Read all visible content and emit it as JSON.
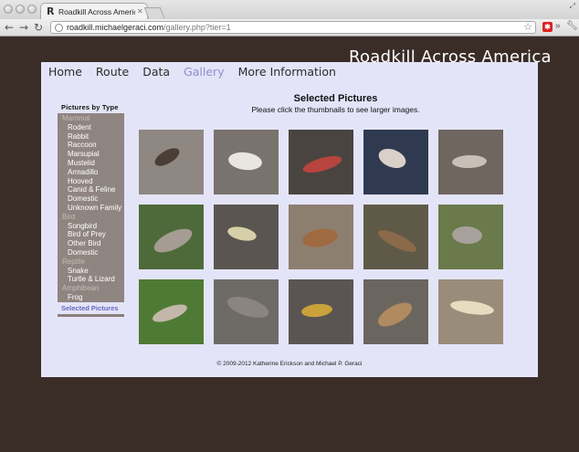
{
  "browser": {
    "tab_title": "Roadkill Across America - G",
    "tab_favicon": "R",
    "url_host": "roadkill.michaelgeraci.com",
    "url_path": "/gallery.php?tier=1",
    "icons": [
      "back-icon",
      "forward-icon",
      "reload-icon",
      "globe-icon",
      "star-icon",
      "extension-icon",
      "more-icon",
      "wrench-icon"
    ]
  },
  "site": {
    "title": "Roadkill Across America"
  },
  "nav": {
    "items": [
      {
        "label": "Home"
      },
      {
        "label": "Route"
      },
      {
        "label": "Data"
      },
      {
        "label": "Gallery",
        "active": true
      },
      {
        "label": "More Information"
      }
    ],
    "active_color": "#8d8fd0"
  },
  "sidebar": {
    "title": "Pictures by Type",
    "items": [
      {
        "label": "Mammal",
        "kind": "category"
      },
      {
        "label": "Rodent",
        "kind": "sub"
      },
      {
        "label": "Rabbit",
        "kind": "sub"
      },
      {
        "label": "Raccoon",
        "kind": "sub"
      },
      {
        "label": "Marsupial",
        "kind": "sub"
      },
      {
        "label": "Mustelid",
        "kind": "sub"
      },
      {
        "label": "Armadillo",
        "kind": "sub"
      },
      {
        "label": "Hooved",
        "kind": "sub"
      },
      {
        "label": "Canid & Feline",
        "kind": "sub"
      },
      {
        "label": "Domestic",
        "kind": "sub"
      },
      {
        "label": "Unknown Family",
        "kind": "sub"
      },
      {
        "label": "Bird",
        "kind": "category"
      },
      {
        "label": "Songbird",
        "kind": "sub"
      },
      {
        "label": "Bird of Prey",
        "kind": "sub"
      },
      {
        "label": "Other Bird",
        "kind": "sub"
      },
      {
        "label": "Domestic",
        "kind": "sub"
      },
      {
        "label": "Reptile",
        "kind": "category"
      },
      {
        "label": "Snake",
        "kind": "sub"
      },
      {
        "label": "Turtle & Lizard",
        "kind": "sub"
      },
      {
        "label": "Amphibean",
        "kind": "category"
      },
      {
        "label": "Frog",
        "kind": "sub"
      }
    ],
    "selected_link": "Selected Pictures"
  },
  "gallery": {
    "heading": "Selected Pictures",
    "subheading": "Please click the thumbnails to see larger images.",
    "thumbnails": [
      {
        "bg": "#8f8782",
        "fg": "#4a3e36"
      },
      {
        "bg": "#7a726c",
        "fg": "#e9e6e0"
      },
      {
        "bg": "#4a4440",
        "fg": "#b7443e"
      },
      {
        "bg": "#2f3a50",
        "fg": "#d9d0c9"
      },
      {
        "bg": "#6f6660",
        "fg": "#c8bfb6"
      },
      {
        "bg": "#4e6a3a",
        "fg": "#a59c93"
      },
      {
        "bg": "#5a5550",
        "fg": "#d6d0a8"
      },
      {
        "bg": "#8d7f70",
        "fg": "#a06a40"
      },
      {
        "bg": "#5f5a48",
        "fg": "#8a6a4a"
      },
      {
        "bg": "#6a7a4a",
        "fg": "#a8a09a"
      },
      {
        "bg": "#4f7a35",
        "fg": "#c3b7aa"
      },
      {
        "bg": "#6e6a66",
        "fg": "#8a8580"
      },
      {
        "bg": "#5a5552",
        "fg": "#c9a23a"
      },
      {
        "bg": "#6b6560",
        "fg": "#b08a60"
      },
      {
        "bg": "#9a8c7a",
        "fg": "#e8dcc0"
      }
    ]
  },
  "footer": {
    "text": "© 2009-2012 Katherine Erickson and Michael P. Geraci"
  }
}
